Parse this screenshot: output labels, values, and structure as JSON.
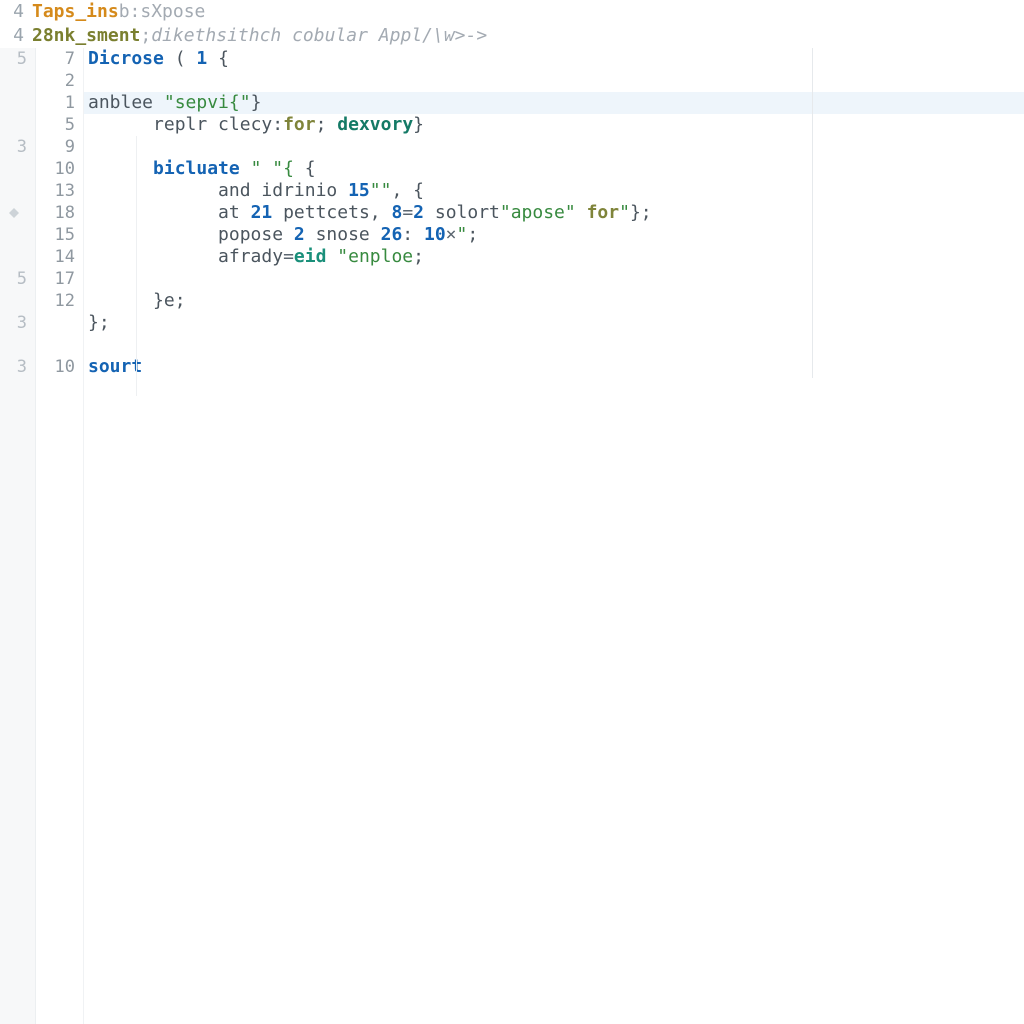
{
  "header": {
    "row1_num": "4",
    "row1_orange": "Taps_ins",
    "row1_gray": " b:sXpose",
    "row2_num": "4",
    "row2_olive": "28nk_sment",
    "row2_punc": ";",
    "row2_gray": " dikethsithch  cobular  Appl/\\w>->"
  },
  "gutter_left": [
    "5",
    "",
    "",
    "",
    "3",
    "",
    "",
    "",
    "",
    "",
    "5",
    "",
    "3",
    "",
    "3"
  ],
  "gutter_right": [
    "7",
    "2",
    "1",
    "5",
    "9",
    "10",
    "13",
    "18",
    "15",
    "14",
    "17",
    "12",
    "",
    "",
    "10"
  ],
  "marker_row_index": 7,
  "highlight_row_index": 2,
  "code": {
    "r0": {
      "indent": 0,
      "parts": [
        [
          "key",
          "Dicrose"
        ],
        [
          "txt",
          " "
        ],
        [
          "pun",
          "("
        ],
        [
          "txt",
          " "
        ],
        [
          "num",
          "1"
        ],
        [
          "txt",
          " "
        ],
        [
          "pun",
          "{"
        ]
      ]
    },
    "r1": {
      "indent": 0,
      "parts": []
    },
    "r2": {
      "indent": 0,
      "parts": [
        [
          "txt",
          "anblee "
        ],
        [
          "str",
          "\"sepvi{\""
        ],
        [
          "pun",
          "}"
        ]
      ]
    },
    "r3": {
      "indent": 6,
      "parts": [
        [
          "txt",
          "replr clecy"
        ],
        [
          "pun",
          ":"
        ],
        [
          "olive",
          "for"
        ],
        [
          "pun",
          ";"
        ],
        [
          "txt",
          " "
        ],
        [
          "tealk",
          "dexvory"
        ],
        [
          "pun",
          "}"
        ]
      ]
    },
    "r4": {
      "indent": 0,
      "parts": []
    },
    "r5": {
      "indent": 6,
      "parts": [
        [
          "key",
          "bicluate"
        ],
        [
          "txt",
          " "
        ],
        [
          "str",
          "\" \"{"
        ],
        [
          "txt",
          " "
        ],
        [
          "pun",
          "{"
        ]
      ]
    },
    "r6": {
      "indent": 12,
      "parts": [
        [
          "txt",
          "and idrinio "
        ],
        [
          "num",
          "15"
        ],
        [
          "str",
          "\"\""
        ],
        [
          "pun",
          ","
        ],
        [
          "txt",
          " "
        ],
        [
          "pun",
          "{"
        ]
      ]
    },
    "r7": {
      "indent": 12,
      "parts": [
        [
          "txt",
          "at "
        ],
        [
          "num",
          "21"
        ],
        [
          "txt",
          " pettcets"
        ],
        [
          "pun",
          ","
        ],
        [
          "txt",
          " "
        ],
        [
          "num",
          "8"
        ],
        [
          "op",
          "="
        ],
        [
          "num",
          "2"
        ],
        [
          "txt",
          " solort"
        ],
        [
          "str",
          "\"apose\""
        ],
        [
          "txt",
          " "
        ],
        [
          "olive",
          "for"
        ],
        [
          "str",
          "\""
        ],
        [
          "pun",
          "};"
        ]
      ]
    },
    "r8": {
      "indent": 12,
      "parts": [
        [
          "txt",
          "popose "
        ],
        [
          "num",
          "2"
        ],
        [
          "txt",
          " snose "
        ],
        [
          "num",
          "26"
        ],
        [
          "pun",
          ":"
        ],
        [
          "txt",
          " "
        ],
        [
          "num",
          "10"
        ],
        [
          "op",
          "×"
        ],
        [
          "str",
          "\""
        ],
        [
          "pun",
          ";"
        ]
      ]
    },
    "r9": {
      "indent": 12,
      "parts": [
        [
          "txt",
          "afrady"
        ],
        [
          "op",
          "="
        ],
        [
          "teal",
          "eid"
        ],
        [
          "txt",
          " "
        ],
        [
          "str",
          "\"enploe"
        ],
        [
          "pun",
          ";"
        ]
      ]
    },
    "r10": {
      "indent": 0,
      "parts": []
    },
    "r11": {
      "indent": 6,
      "parts": [
        [
          "pun",
          "}e;"
        ]
      ]
    },
    "r12": {
      "indent": 0,
      "parts": [
        [
          "pun",
          "};"
        ]
      ]
    },
    "r13": {
      "indent": 0,
      "parts": []
    },
    "r14": {
      "indent": 0,
      "parts": [
        [
          "keyb",
          "sourt"
        ]
      ]
    }
  }
}
